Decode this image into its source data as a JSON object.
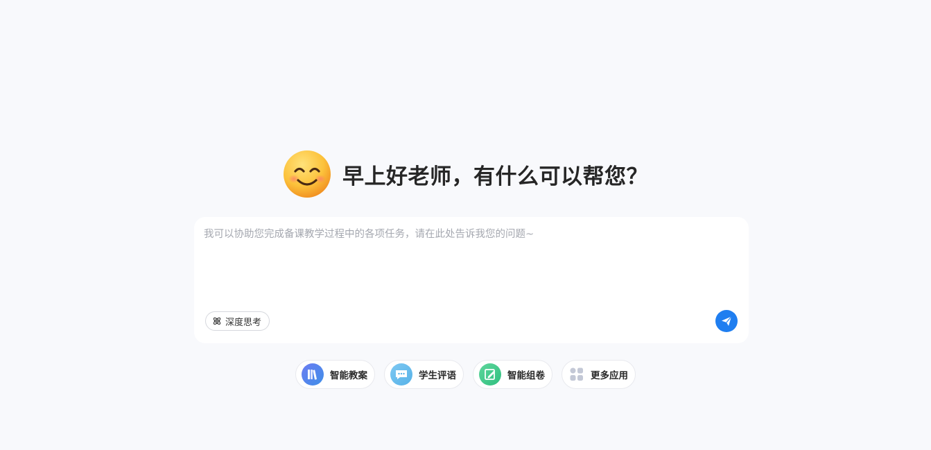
{
  "greeting": {
    "emoji_icon": "smiling-face-icon",
    "text": "早上好老师，有什么可以帮您？"
  },
  "composer": {
    "placeholder": "我可以协助您完成备课教学过程中的各项任务，请在此处告诉我您的问题~",
    "value": "",
    "deep_think_label": "深度思考",
    "deep_think_icon": "atom-icon",
    "send_icon": "paper-plane-icon"
  },
  "quick_actions": [
    {
      "label": "智能教案",
      "icon": "books-icon"
    },
    {
      "label": "学生评语",
      "icon": "chat-bubble-icon"
    },
    {
      "label": "智能组卷",
      "icon": "edit-paper-icon"
    },
    {
      "label": "更多应用",
      "icon": "apps-grid-icon"
    }
  ],
  "colors": {
    "page_bg": "#f8f9fc",
    "accent": "#1f7ef0",
    "card_bg": "#ffffff"
  }
}
